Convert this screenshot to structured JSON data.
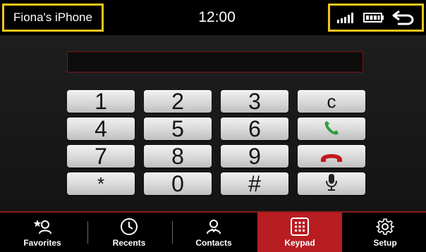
{
  "header": {
    "device_name": "Fiona's iPhone",
    "time": "12:00",
    "highlight_color": "#f5c518",
    "status_icons": [
      "signal-icon",
      "battery-icon",
      "back-icon"
    ]
  },
  "dialer": {
    "number_value": "",
    "keys": [
      {
        "label": "1",
        "name": "key-1"
      },
      {
        "label": "2",
        "name": "key-2"
      },
      {
        "label": "3",
        "name": "key-3"
      },
      {
        "label": "c",
        "name": "clear-button"
      },
      {
        "label": "4",
        "name": "key-4"
      },
      {
        "label": "5",
        "name": "key-5"
      },
      {
        "label": "6",
        "name": "key-6"
      },
      {
        "label": "7",
        "name": "key-7"
      },
      {
        "label": "8",
        "name": "key-8"
      },
      {
        "label": "9",
        "name": "key-9"
      },
      {
        "label": "*",
        "name": "key-star"
      },
      {
        "label": "0",
        "name": "key-0"
      },
      {
        "label": "#",
        "name": "key-hash"
      }
    ],
    "action_icons": [
      "call-icon",
      "end-call-icon",
      "microphone-icon"
    ],
    "call_color": "#2e9e3c",
    "end_color": "#c4161c"
  },
  "tabs": [
    {
      "label": "Favorites",
      "icon": "favorites-icon"
    },
    {
      "label": "Recents",
      "icon": "clock-icon"
    },
    {
      "label": "Contacts",
      "icon": "contacts-icon"
    },
    {
      "label": "Keypad",
      "icon": "keypad-icon",
      "active": true
    },
    {
      "label": "Setup",
      "icon": "gear-icon"
    }
  ],
  "accent_color": "#b81d22"
}
